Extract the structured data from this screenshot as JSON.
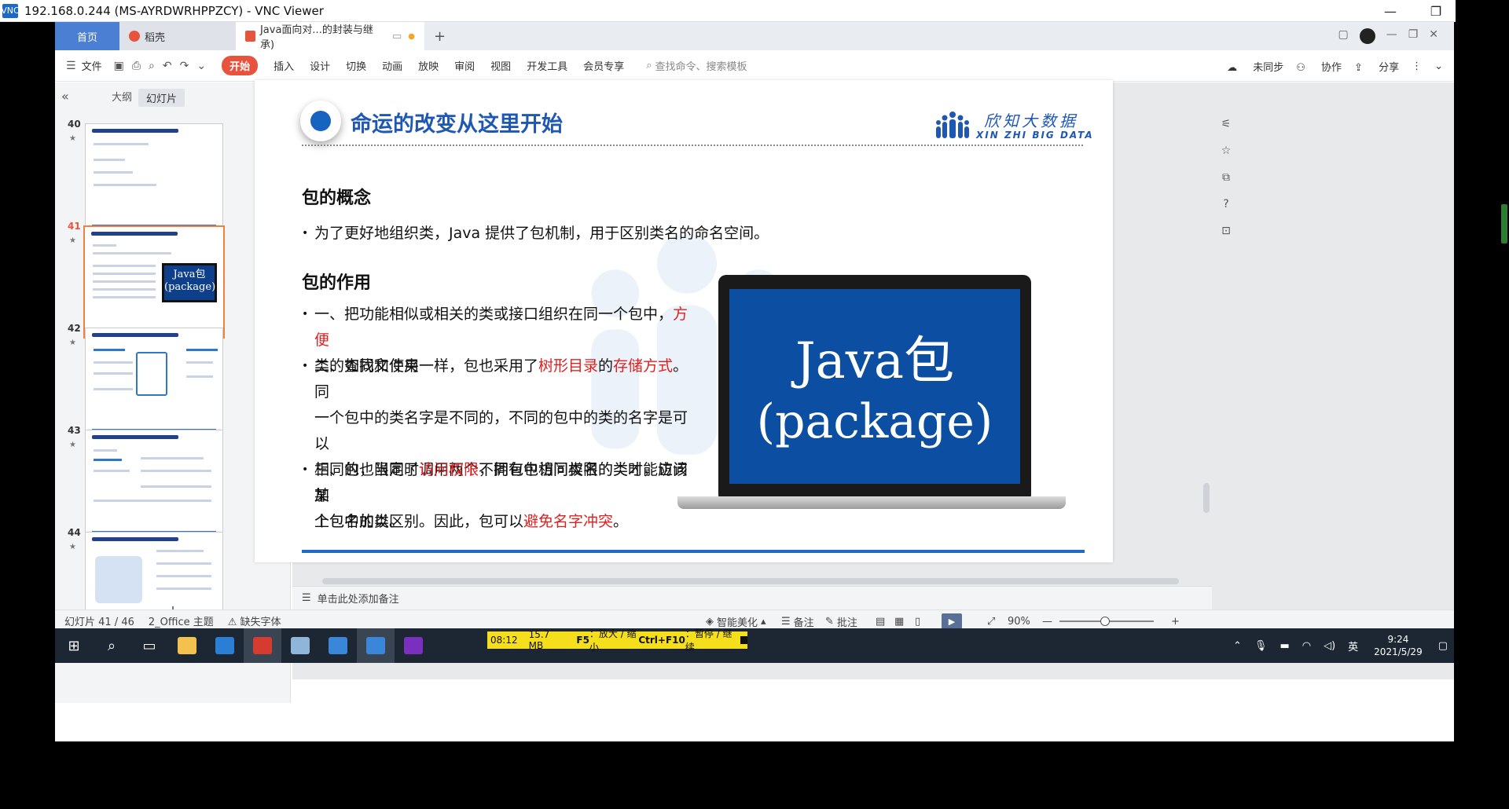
{
  "vnc": {
    "title": "192.168.0.244 (MS-AYRDWRHPPZCY) - VNC Viewer",
    "icon": "VNC"
  },
  "tabs": {
    "home": "首页",
    "shell": "稻壳",
    "doc": "Java面向对...的封装与继承)",
    "add": "+"
  },
  "menu": {
    "file": "文件",
    "items": [
      "开始",
      "插入",
      "设计",
      "切换",
      "动画",
      "放映",
      "审阅",
      "视图",
      "开发工具",
      "会员专享"
    ],
    "search_placeholder": "查找命令、搜索模板",
    "sync": "未同步",
    "collab": "协作",
    "share": "分享"
  },
  "leftpane": {
    "outline_tab": "大纲",
    "slides_tab": "幻灯片",
    "thumbnails": [
      {
        "num": "40",
        "star": "★"
      },
      {
        "num": "41",
        "star": "★",
        "java": "Java包",
        "pkg": "(package)"
      },
      {
        "num": "42",
        "star": "★"
      },
      {
        "num": "43",
        "star": "★"
      },
      {
        "num": "44",
        "star": "★"
      }
    ],
    "add": "+"
  },
  "slide": {
    "title": "命运的改变从这里开始",
    "logo_cn": "欣知大数据",
    "logo_en": "XIN ZHI BIG DATA",
    "h_concept": "包的概念",
    "concept_text": "为了更好地组织类，Java 提供了包机制，用于区别类名的命名空间。",
    "h_role": "包的作用",
    "b1_a": "一、把功能相似或相关的类或接口组织在同一个包中，",
    "b1_red": "方便",
    "b1_b": "类的查找和使用",
    "b2_a": "二、如同文件夹一样，包也采用了",
    "b2_red1": "树形目录",
    "b2_b": "的",
    "b2_red2": "存储方式",
    "b2_c": "。同",
    "b2_line2": "一个包中的类名字是不同的，不同的包中的类的名字是可以",
    "b2_line3": "相同的，当同时调用两个不同包中相同类名的类时，应该加",
    "b2_line4a": "上包名加以区别。因此，包可以",
    "b2_red3": "避免名字冲突",
    "b2_line4b": "。",
    "b3_a": "三、包也限定了",
    "b3_red": "访问权限",
    "b3_b": "，拥有包访问权限的类才能访问某",
    "b3_line2": "个包中的类。",
    "laptop_l1": "Java包",
    "laptop_l2": "(package)"
  },
  "notes": "单击此处添加备注",
  "status": {
    "slide": "幻灯片 41 / 46",
    "theme": "2_Office 主题",
    "font": "缺失字体",
    "beautify": "智能美化",
    "comments_note": "备注",
    "annot": "批注",
    "zoom": "90%"
  },
  "recorder": {
    "time": "08:12",
    "size": "15.7 MB",
    "key": "F5",
    "hint1": "：放大 / 缩小 ",
    "key2": "Ctrl+F10",
    "hint2": "：暂停 / 继续"
  },
  "tray": {
    "lang": "英",
    "time": "9:24",
    "date": "2021/5/29"
  }
}
